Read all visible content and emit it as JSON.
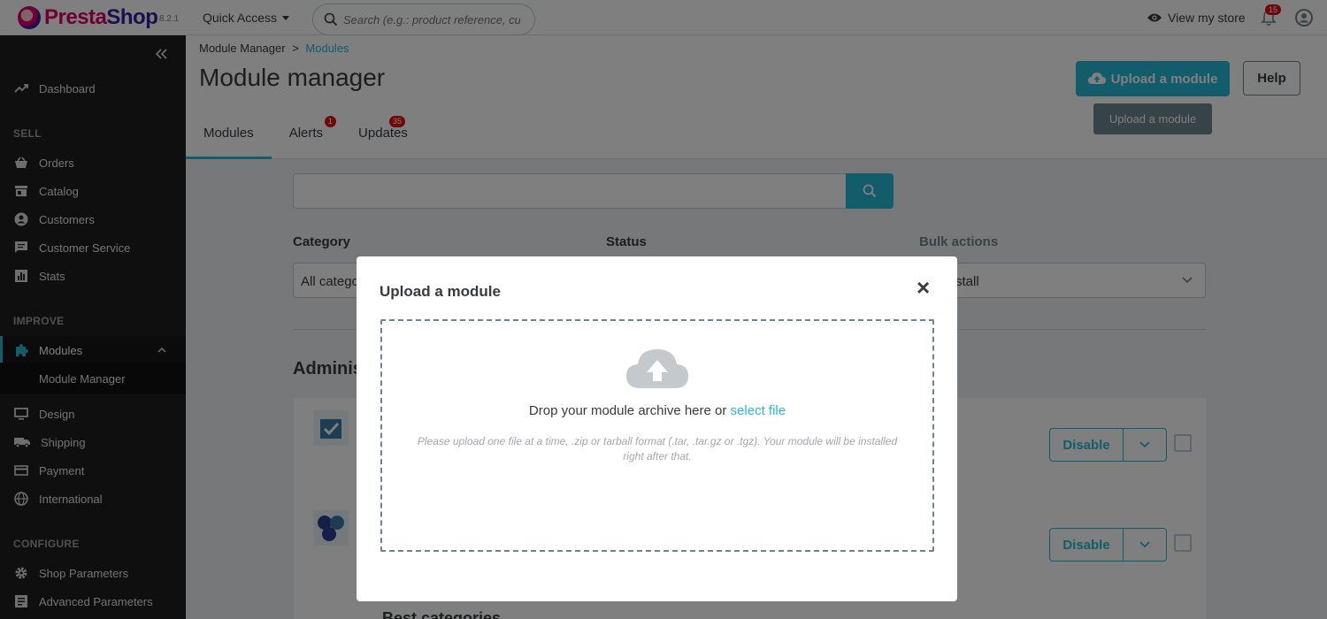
{
  "topbar": {
    "logo_main": "Presta",
    "logo_accent": "Shop",
    "version": "8.2.1",
    "quick_access": "Quick Access",
    "search_placeholder": "Search (e.g.: product reference, custon",
    "view_store": "View my store",
    "notification_count": "15"
  },
  "sidebar": {
    "dashboard": "Dashboard",
    "sell_heading": "SELL",
    "orders": "Orders",
    "catalog": "Catalog",
    "customers": "Customers",
    "customer_service": "Customer Service",
    "stats": "Stats",
    "improve_heading": "IMPROVE",
    "modules": "Modules",
    "module_manager": "Module Manager",
    "design": "Design",
    "shipping": "Shipping",
    "payment": "Payment",
    "international": "International",
    "configure_heading": "CONFIGURE",
    "shop_parameters": "Shop Parameters",
    "advanced_parameters": "Advanced Parameters"
  },
  "header": {
    "breadcrumb_parent": "Module Manager",
    "breadcrumb_sep": ">",
    "breadcrumb_current": "Modules",
    "title": "Module manager",
    "upload_button": "Upload a module",
    "help_button": "Help",
    "tooltip": "Upload a module",
    "tabs": [
      {
        "label": "Modules",
        "badge": ""
      },
      {
        "label": "Alerts",
        "badge": "1"
      },
      {
        "label": "Updates",
        "badge": "35"
      }
    ]
  },
  "filters": {
    "category_label": "Category",
    "category_value": "All catego",
    "status_label": "Status",
    "bulk_label": "Bulk actions",
    "bulk_value": "stall"
  },
  "content": {
    "section_title": "Adminis",
    "disable_label": "Disable",
    "partial_module_name": "Best categories"
  },
  "modal": {
    "title": "Upload a module",
    "close": "×",
    "drop_text": "Drop your module archive here or",
    "select_file": "select file",
    "help": "Please upload one file at a time, .zip or tarball format (.tar, .tar.gz or .tgz). Your module will be installed right after that."
  },
  "colors": {
    "accent": "#25b9d7",
    "sidebar_bg": "#1f1f1f",
    "badge": "#e50c0c"
  }
}
